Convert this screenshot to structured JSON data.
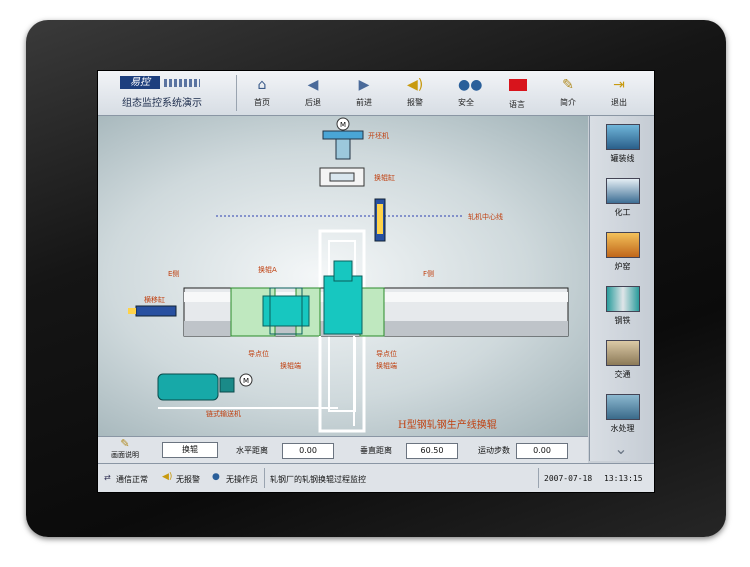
{
  "header": {
    "logo_text": "易控",
    "subtitle": "组态监控系统演示",
    "nav": [
      {
        "label": "首页",
        "icon": "home-icon"
      },
      {
        "label": "后退",
        "icon": "back-icon"
      },
      {
        "label": "前进",
        "icon": "forward-icon"
      },
      {
        "label": "报警",
        "icon": "alarm-icon"
      },
      {
        "label": "安全",
        "icon": "users-icon"
      },
      {
        "label": "语言",
        "icon": "flag-icon"
      },
      {
        "label": "简介",
        "icon": "note-icon"
      },
      {
        "label": "退出",
        "icon": "exit-icon"
      }
    ]
  },
  "sidebar": {
    "items": [
      {
        "label": "罐装线"
      },
      {
        "label": "化工"
      },
      {
        "label": "炉窑"
      },
      {
        "label": "钢铁"
      },
      {
        "label": "交通"
      },
      {
        "label": "水处理"
      }
    ]
  },
  "diagram": {
    "title": "H型钢轧钢生产线换辊",
    "labels": {
      "motor_top": "开坯机",
      "roll_cyl": "换辊缸",
      "center_line": "轧机中心线",
      "e_side": "E侧",
      "f_side": "F侧",
      "a_label": "换辊A",
      "shift_cyl": "横移缸",
      "pt_a": "导点位",
      "pt_a2": "换辊端",
      "pt_b": "导点位",
      "pt_b2": "换辊端",
      "chain": "链式输送机"
    }
  },
  "controls": {
    "help_label": "画面说明",
    "mode_button": "换辊",
    "h_dist_label": "水平距离",
    "h_dist_value": "0.00",
    "v_dist_label": "垂直距离",
    "v_dist_value": "60.50",
    "steps_label": "运动步数",
    "steps_value": "0.00"
  },
  "status": {
    "comm": "通信正常",
    "alarm": "无报警",
    "operator": "无操作员",
    "message": "轧钢厂的轧钢换辊过程监控",
    "date": "2007-07-18",
    "time": "13:13:15"
  },
  "colors": {
    "accent": "#1d3f7e",
    "equipment": "#17c7c0",
    "label": "#c04010"
  }
}
